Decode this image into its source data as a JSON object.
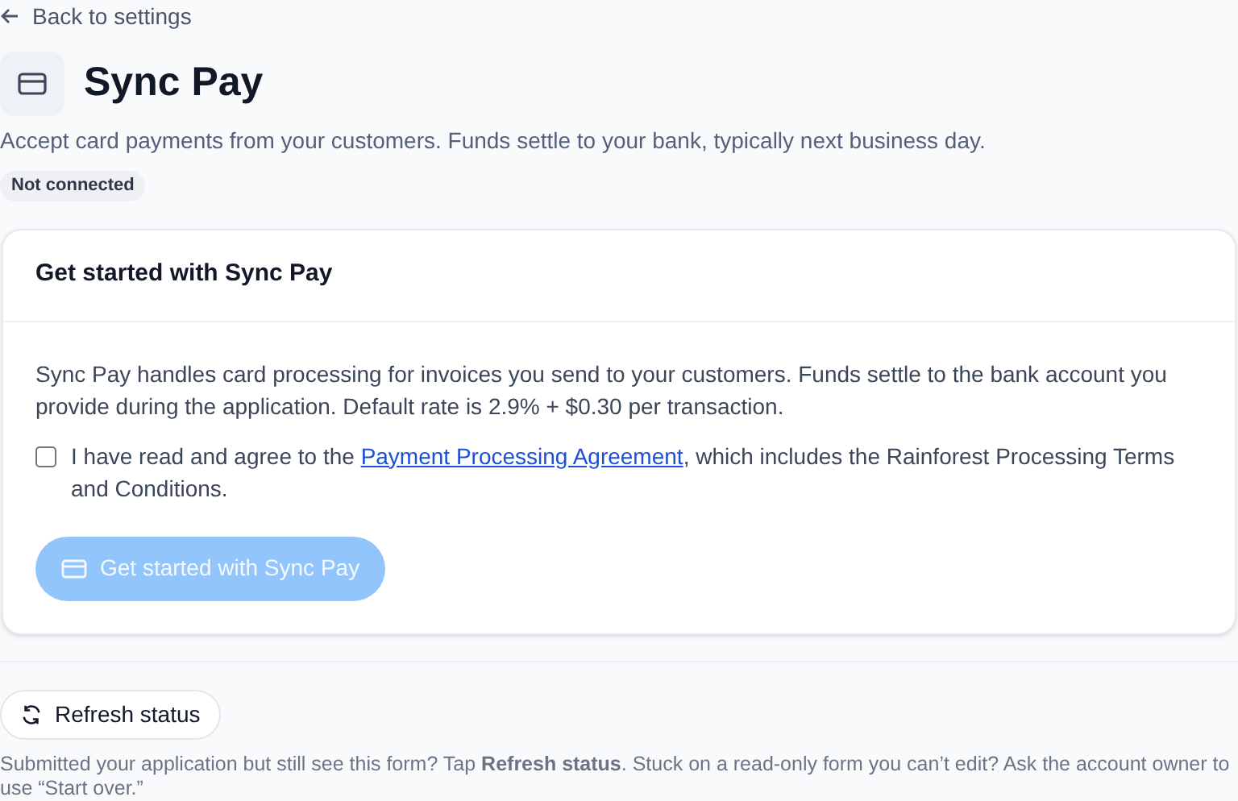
{
  "back_link": {
    "label": "Back to settings"
  },
  "header": {
    "title": "Sync Pay",
    "description": "Accept card payments from your customers. Funds settle to your bank, typically next business day.",
    "status_badge": "Not connected"
  },
  "card": {
    "title": "Get started with Sync Pay",
    "body": "Sync Pay handles card processing for invoices you send to your customers. Funds settle to the bank account you provide during the application. Default rate is 2.9% + $0.30 per transaction.",
    "consent": {
      "checked": false,
      "before": "I have read and agree to the ",
      "link": "Payment Processing Agreement",
      "after": ", which includes the Rainforest Processing Terms and Conditions."
    },
    "button": {
      "label": "Get started with Sync Pay",
      "disabled": true
    }
  },
  "refresh_button": {
    "label": "Refresh status"
  },
  "help_text": "Submitted your application but still see this form? Tap **Refresh status**. Stuck on a read-only form you can’t edit? Ask the account owner to use “Start over.”"
}
